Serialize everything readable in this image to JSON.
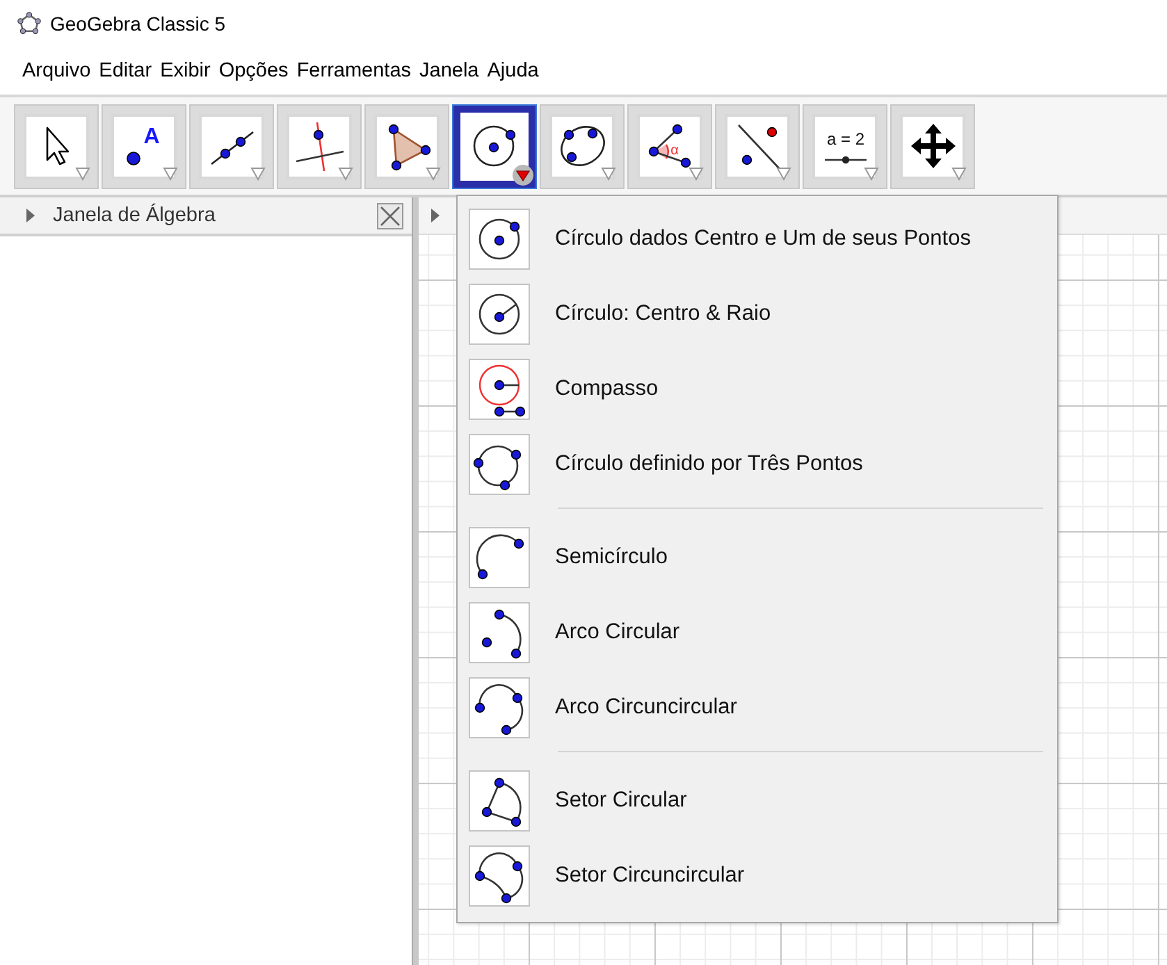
{
  "window": {
    "title": "GeoGebra Classic 5"
  },
  "menu": [
    "Arquivo",
    "Editar",
    "Exibir",
    "Opções",
    "Ferramentas",
    "Janela",
    "Ajuda"
  ],
  "tools": [
    {
      "selected": false
    },
    {
      "selected": false,
      "label": "A"
    },
    {
      "selected": false
    },
    {
      "selected": false
    },
    {
      "selected": false
    },
    {
      "selected": true
    },
    {
      "selected": false
    },
    {
      "selected": false,
      "label": "α"
    },
    {
      "selected": false
    },
    {
      "selected": false,
      "label": "a = 2"
    },
    {
      "selected": false
    }
  ],
  "algebra_panel": {
    "title": "Janela de Álgebra"
  },
  "tool_menu": {
    "groups": [
      [
        {
          "label": "Círculo dados Centro e Um de seus Pontos"
        },
        {
          "label": "Círculo: Centro & Raio"
        },
        {
          "label": "Compasso"
        },
        {
          "label": "Círculo definido por Três Pontos"
        }
      ],
      [
        {
          "label": "Semicírculo"
        },
        {
          "label": "Arco Circular"
        },
        {
          "label": "Arco Circuncircular"
        }
      ],
      [
        {
          "label": "Setor Circular"
        },
        {
          "label": "Setor Circuncircular"
        }
      ]
    ]
  }
}
